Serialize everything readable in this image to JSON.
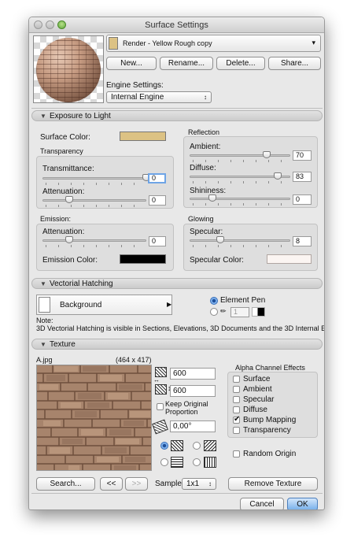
{
  "window": {
    "title": "Surface Settings"
  },
  "header": {
    "surface_name": "Render - Yellow Rough copy",
    "surface_color": "#dcc284",
    "buttons": {
      "new": "New...",
      "rename": "Rename...",
      "delete": "Delete...",
      "share": "Share..."
    },
    "engine_label": "Engine Settings:",
    "engine_value": "Internal Engine"
  },
  "exposure": {
    "section_title": "Exposure to Light",
    "surface_color_label": "Surface Color:",
    "surface_color": "#dcc284",
    "transparency_group": "Transparency",
    "transmittance_label": "Transmittance:",
    "transmittance_value": "0",
    "attenuation_label": "Attenuation:",
    "attenuation_value": "0",
    "reflection_group": "Reflection",
    "ambient_label": "Ambient:",
    "ambient_value": "70",
    "diffuse_label": "Diffuse:",
    "diffuse_value": "83",
    "shininess_label": "Shininess:",
    "shininess_value": "0",
    "emission_group": "Emission:",
    "emission_attenuation_label": "Attenuation:",
    "emission_attenuation_value": "0",
    "emission_color_label": "Emission Color:",
    "emission_color": "#000000",
    "glowing_group": "Glowing",
    "specular_label": "Specular:",
    "specular_value": "8",
    "specular_color_label": "Specular Color:",
    "specular_color": "#fbf5f2"
  },
  "hatching": {
    "section_title": "Vectorial Hatching",
    "background_label": "Background",
    "element_pen_label": "Element Pen",
    "pen_number": "1",
    "note_label": "Note:",
    "note_text": "3D Vectorial Hatching is visible in Sections, Elevations, 3D Documents and the 3D Internal Engine."
  },
  "texture": {
    "section_title": "Texture",
    "file_name": "A.jpg",
    "dimensions": "(464 x 417)",
    "width_value": "600",
    "height_value": "600",
    "keep_proportion_label": "Keep Original Proportion",
    "angle_value": "0,00°",
    "alpha_group": "Alpha Channel Effects",
    "alpha_options": [
      {
        "label": "Surface",
        "checked": false
      },
      {
        "label": "Ambient",
        "checked": false
      },
      {
        "label": "Specular",
        "checked": false
      },
      {
        "label": "Diffuse",
        "checked": false
      },
      {
        "label": "Bump Mapping",
        "checked": true
      },
      {
        "label": "Transparency",
        "checked": false
      }
    ],
    "random_origin_label": "Random Origin",
    "search_button": "Search...",
    "prev_button": "<<",
    "next_button": ">>",
    "sample_label": "Sample:",
    "sample_value": "1x1",
    "remove_button": "Remove Texture"
  },
  "footer": {
    "cancel": "Cancel",
    "ok": "OK"
  },
  "colors": {
    "accent_focus": "#6ea4e6",
    "default_button": "#74aeea"
  }
}
